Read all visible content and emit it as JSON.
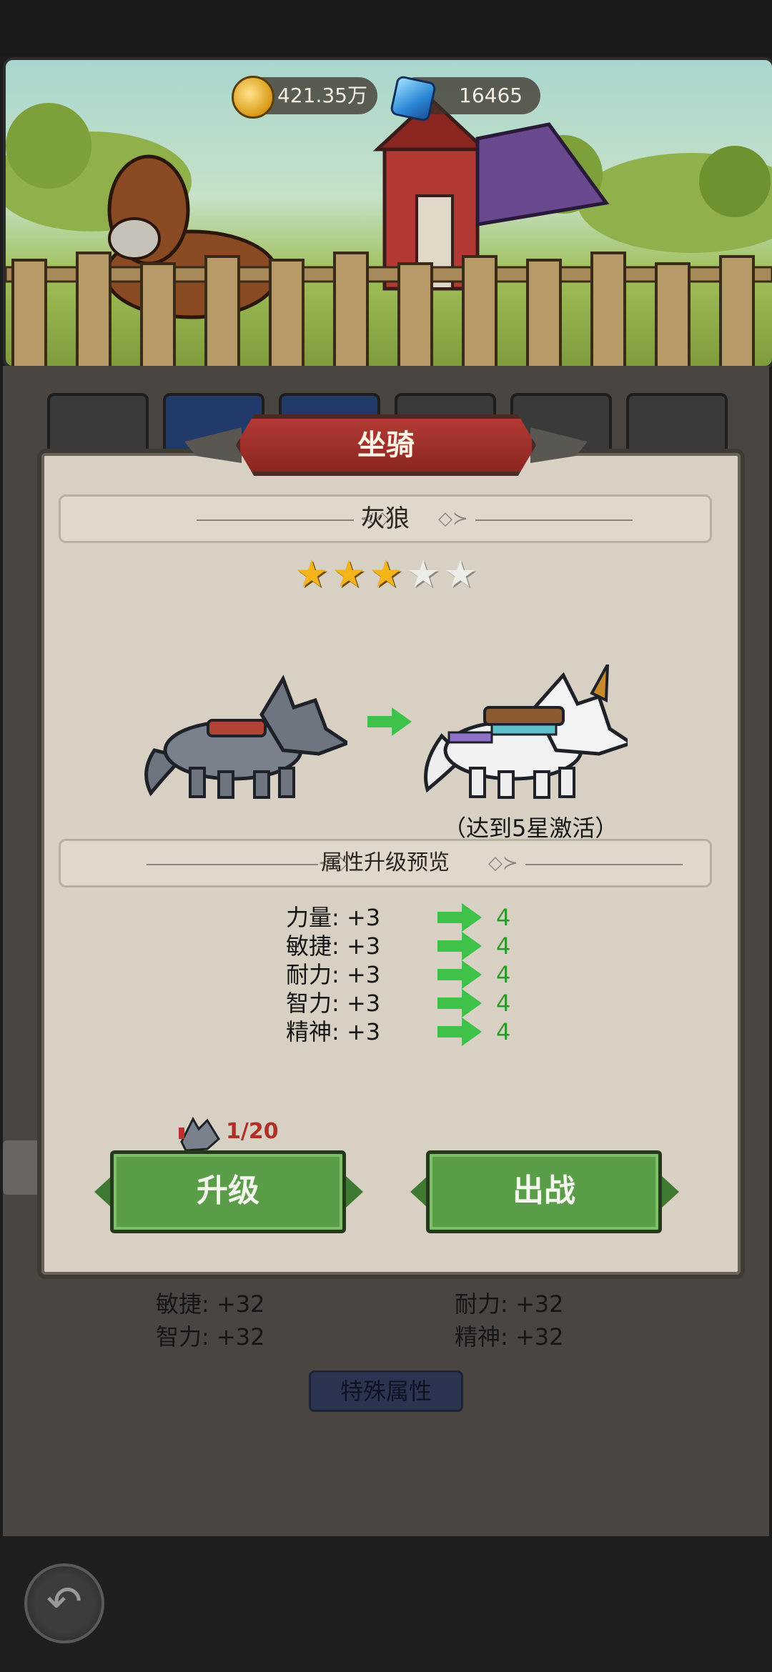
{
  "currency": {
    "gold": "421.35万",
    "gems": "16465"
  },
  "dialog": {
    "title": "坐骑",
    "mount_name": "灰狼",
    "stars_filled": 3,
    "stars_total": 5,
    "activation_note": "（达到5星激活）",
    "preview_header": "属性升级预览",
    "stats": [
      {
        "label": "力量: +3",
        "next": "4"
      },
      {
        "label": "敏捷: +3",
        "next": "4"
      },
      {
        "label": "耐力: +3",
        "next": "4"
      },
      {
        "label": "智力: +3",
        "next": "4"
      },
      {
        "label": "精神: +3",
        "next": "4"
      }
    ],
    "shard_count": "1/20",
    "upgrade_label": "升级",
    "deploy_label": "出战"
  },
  "background_stats": {
    "left_1": "敏捷: +32",
    "right_1": "耐力: +32",
    "left_2": "智力: +32",
    "right_2": "精神: +32"
  },
  "special_button_label": "特殊属性",
  "icons": {
    "gold": "coin-icon",
    "gems": "gem-icon",
    "back": "back-arrow-icon"
  }
}
